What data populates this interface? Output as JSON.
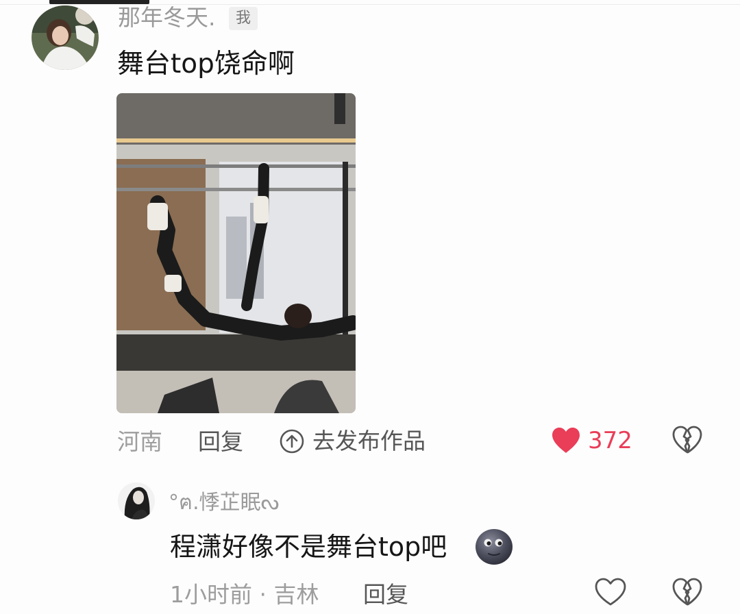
{
  "comment": {
    "username": "那年冬天.",
    "badge": "我",
    "text": "舞台top饶命啊",
    "location": "河南",
    "reply_label": "回复",
    "publish_label": "去发布作品",
    "like_count": "372",
    "liked": true
  },
  "reply": {
    "username": "°ฅ.悸芷眠ᔓ",
    "text": "程潇好像不是舞台top吧",
    "emoji": "new-moon-face",
    "time_location": "1小时前 · 吉林",
    "reply_label": "回复",
    "liked": false
  },
  "colors": {
    "like_red": "#ea3d58",
    "secondary_text": "#9d9d9d",
    "primary_text": "#161616"
  }
}
